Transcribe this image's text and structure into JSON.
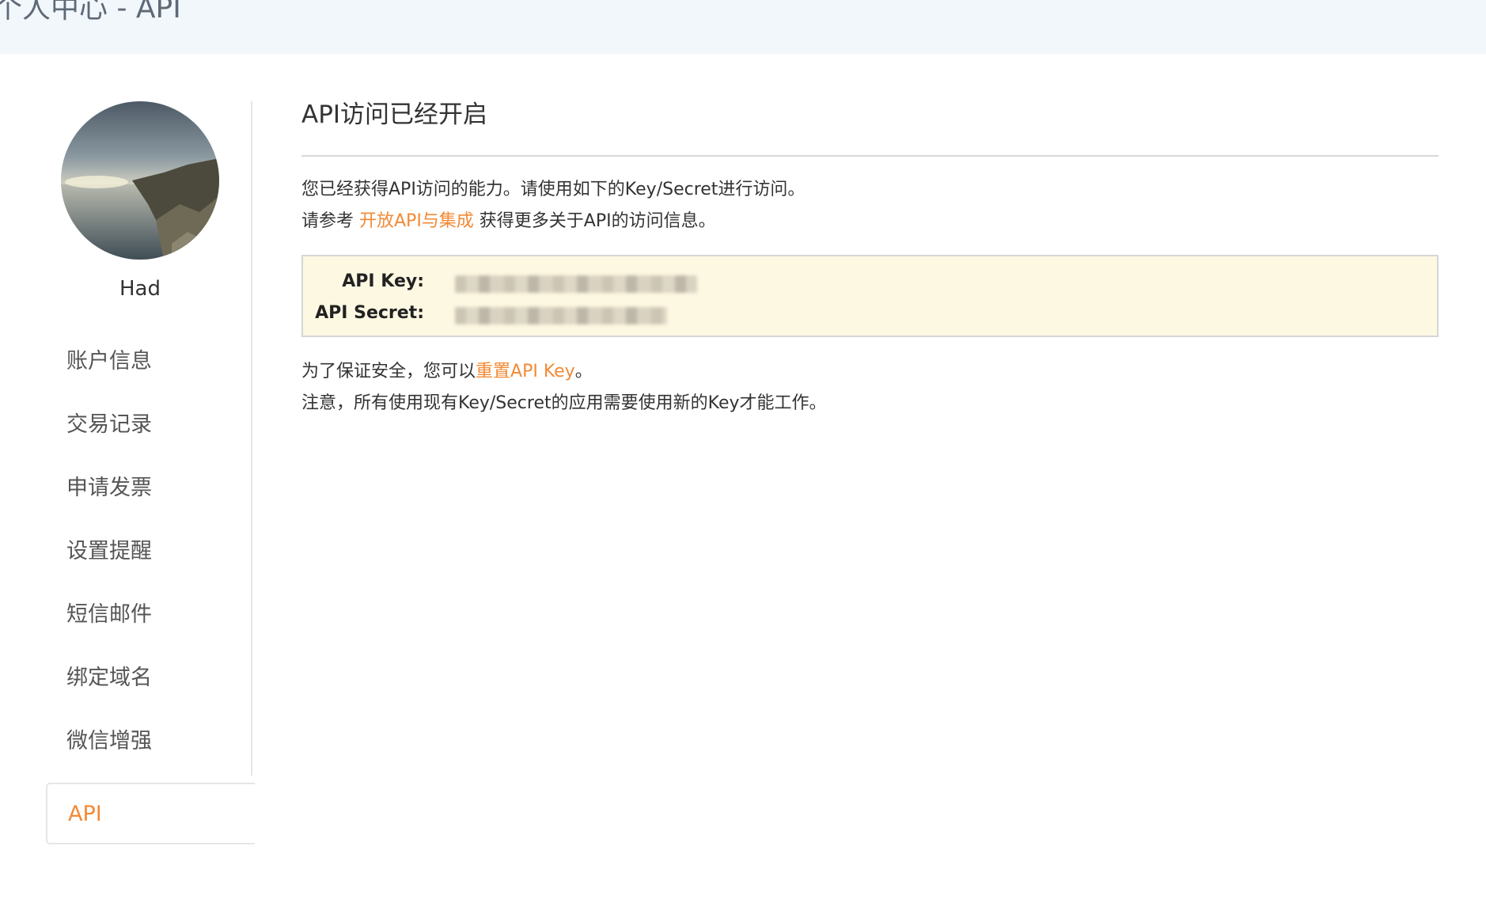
{
  "header": {
    "title": "个人中心 - API"
  },
  "sidebar": {
    "username": "Had",
    "items": [
      {
        "label": "账户信息",
        "active": false
      },
      {
        "label": "交易记录",
        "active": false
      },
      {
        "label": "申请发票",
        "active": false
      },
      {
        "label": "设置提醒",
        "active": false
      },
      {
        "label": "短信邮件",
        "active": false
      },
      {
        "label": "绑定域名",
        "active": false
      },
      {
        "label": "微信增强",
        "active": false
      },
      {
        "label": "API",
        "active": true
      }
    ]
  },
  "main": {
    "heading": "API访问已经开启",
    "intro_line1": "您已经获得API访问的能力。请使用如下的Key/Secret进行访问。",
    "intro_line2_prefix": "请参考 ",
    "intro_line2_link": "开放API与集成",
    "intro_line2_suffix": " 获得更多关于API的访问信息。",
    "keys": {
      "api_key_label": "API Key:",
      "api_secret_label": "API Secret:"
    },
    "security_line1_prefix": "为了保证安全，您可以",
    "security_line1_link": "重置API Key",
    "security_line1_suffix": "。",
    "security_line2": "注意，所有使用现有Key/Secret的应用需要使用新的Key才能工作。"
  },
  "colors": {
    "accent": "#f28a36",
    "key_box_bg": "#fdf8e2",
    "banner_bg": "#f2f7fc"
  }
}
